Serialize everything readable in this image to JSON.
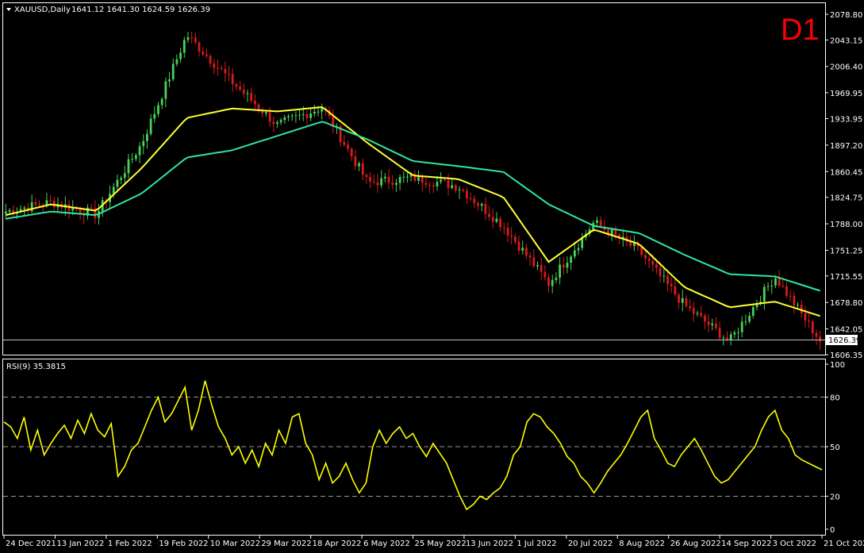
{
  "header": {
    "symbol": "XAUUSD,Daily",
    "ohlc": "1641.12 1641.30 1624.59 1626.39",
    "timeframe": "D1"
  },
  "price_axis": {
    "ticks": [
      "2078.80",
      "2043.15",
      "2006.40",
      "1969.95",
      "1933.95",
      "1897.20",
      "1860.45",
      "1824.75",
      "1788.00",
      "1751.25",
      "1715.55",
      "1678.80",
      "1642.05",
      "1606.35"
    ],
    "current_price_label": "1626.39"
  },
  "rsi": {
    "label": "RSI(9) 35.3815",
    "ticks": [
      "100",
      "80",
      "50",
      "20",
      "0"
    ]
  },
  "date_axis": {
    "labels": [
      "24 Dec 2021",
      "13 Jan 2022",
      "1 Feb 2022",
      "19 Feb 2022",
      "10 Mar 2022",
      "29 Mar 2022",
      "18 Apr 2022",
      "6 May 2022",
      "25 May 2022",
      "13 Jun 2022",
      "1 Jul 2022",
      "20 Jul 2022",
      "8 Aug 2022",
      "26 Aug 2022",
      "14 Sep 2022",
      "3 Oct 2022",
      "21 Oct 2022"
    ]
  },
  "colors": {
    "background": "#000000",
    "bull": "#49d15a",
    "bear": "#d81b1b",
    "ma_fast": "#ffff33",
    "ma_slow": "#2ee6a0",
    "rsi_line": "#ffff00",
    "grid_dash": "#c8c8c8",
    "timeframe": "#ff0000"
  },
  "chart_data": [
    {
      "type": "candlestick",
      "title": "XAUUSD,Daily",
      "ylim": [
        1606.35,
        2078.8
      ],
      "x_start": "24 Dec 2021",
      "x_end": "21 Oct 2022",
      "series": [
        {
          "name": "price",
          "x": [
            "24 Dec 2021",
            "13 Jan 2022",
            "1 Feb 2022",
            "19 Feb 2022",
            "8 Mar 2022",
            "10 Mar 2022",
            "29 Mar 2022",
            "18 Apr 2022",
            "6 May 2022",
            "25 May 2022",
            "13 Jun 2022",
            "1 Jul 2022",
            "20 Jul 2022",
            "8 Aug 2022",
            "26 Aug 2022",
            "14 Sep 2022",
            "28 Sep 2022",
            "3 Oct 2022",
            "21 Oct 2022"
          ],
          "values": [
            1805,
            1818,
            1801,
            1899,
            2050,
            1985,
            1925,
            1950,
            1845,
            1852,
            1840,
            1785,
            1705,
            1790,
            1750,
            1675,
            1625,
            1715,
            1626
          ]
        },
        {
          "name": "ma_fast",
          "values": [
            1800,
            1815,
            1806,
            1865,
            1935,
            1948,
            1944,
            1950,
            1900,
            1855,
            1850,
            1825,
            1735,
            1780,
            1760,
            1700,
            1672,
            1680,
            1660
          ]
        },
        {
          "name": "ma_slow",
          "values": [
            1795,
            1805,
            1800,
            1830,
            1880,
            1890,
            1910,
            1930,
            1905,
            1875,
            1868,
            1860,
            1815,
            1785,
            1775,
            1745,
            1718,
            1715,
            1695
          ]
        }
      ]
    },
    {
      "type": "line",
      "title": "RSI(9) 35.3815",
      "ylim": [
        0,
        100
      ],
      "levels": [
        80,
        50,
        20
      ],
      "series": [
        {
          "name": "RSI(9)",
          "values": [
            65,
            62,
            55,
            68,
            48,
            60,
            45,
            52,
            58,
            63,
            55,
            66,
            58,
            70,
            60,
            56,
            64,
            32,
            38,
            48,
            52,
            62,
            72,
            80,
            65,
            70,
            78,
            86,
            60,
            72,
            90,
            75,
            62,
            55,
            45,
            50,
            40,
            48,
            38,
            52,
            45,
            60,
            52,
            68,
            70,
            52,
            45,
            30,
            40,
            28,
            32,
            40,
            30,
            22,
            28,
            50,
            60,
            52,
            58,
            62,
            55,
            58,
            50,
            44,
            52,
            46,
            40,
            30,
            20,
            12,
            15,
            20,
            18,
            22,
            25,
            32,
            45,
            50,
            65,
            70,
            68,
            62,
            58,
            52,
            44,
            40,
            32,
            28,
            22,
            28,
            35,
            40,
            45,
            52,
            60,
            68,
            72,
            55,
            48,
            40,
            38,
            45,
            50,
            55,
            48,
            40,
            32,
            28,
            30,
            35,
            40,
            45,
            50,
            60,
            68,
            72,
            60,
            55,
            45,
            42,
            40,
            38,
            36
          ]
        }
      ]
    }
  ]
}
